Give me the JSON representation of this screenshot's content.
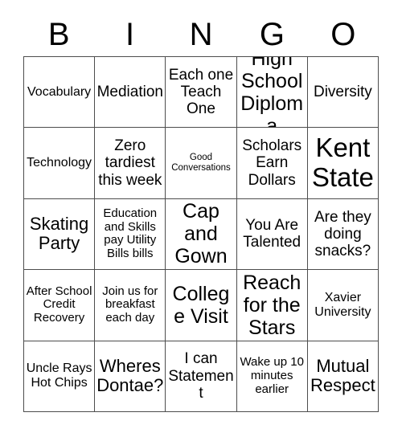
{
  "card": {
    "title": "BINGO",
    "header_letters": [
      "B",
      "I",
      "N",
      "G",
      "O"
    ],
    "grid_size": "5x5",
    "colors": {
      "background": "#ffffff",
      "text": "#000000",
      "border": "#4d4d4d"
    },
    "rows": [
      [
        {
          "text": "Vocabulary",
          "size": "sm"
        },
        {
          "text": "Mediation",
          "size": "md"
        },
        {
          "text": "Each one Teach One",
          "size": "md"
        },
        {
          "text": "High School Diploma",
          "size": "xl"
        },
        {
          "text": "Diversity",
          "size": "md"
        }
      ],
      [
        {
          "text": "Technology",
          "size": "sm"
        },
        {
          "text": "Zero tardiest this week",
          "size": "md"
        },
        {
          "text": "Good Conversations",
          "size": "xxs"
        },
        {
          "text": "Scholars Earn Dollars",
          "size": "md"
        },
        {
          "text": "Kent State",
          "size": "xxl"
        }
      ],
      [
        {
          "text": "Skating Party",
          "size": "lg"
        },
        {
          "text": "Education and Skills pay Utility Bills bills",
          "size": "xs"
        },
        {
          "text": "Cap and Gown",
          "size": "xl"
        },
        {
          "text": "You Are Talented",
          "size": "md"
        },
        {
          "text": "Are they doing snacks?",
          "size": "md"
        }
      ],
      [
        {
          "text": "After School Credit Recovery",
          "size": "xs"
        },
        {
          "text": "Join us for breakfast each day",
          "size": "xs"
        },
        {
          "text": "College Visit",
          "size": "xl"
        },
        {
          "text": "Reach for the Stars",
          "size": "xl"
        },
        {
          "text": "Xavier University",
          "size": "sm"
        }
      ],
      [
        {
          "text": "Uncle Rays Hot Chips",
          "size": "sm"
        },
        {
          "text": "Wheres Dontae?",
          "size": "lg"
        },
        {
          "text": "I can Statement",
          "size": "md"
        },
        {
          "text": "Wake up 10 minutes earlier",
          "size": "xs"
        },
        {
          "text": "Mutual Respect",
          "size": "lg"
        }
      ]
    ]
  }
}
